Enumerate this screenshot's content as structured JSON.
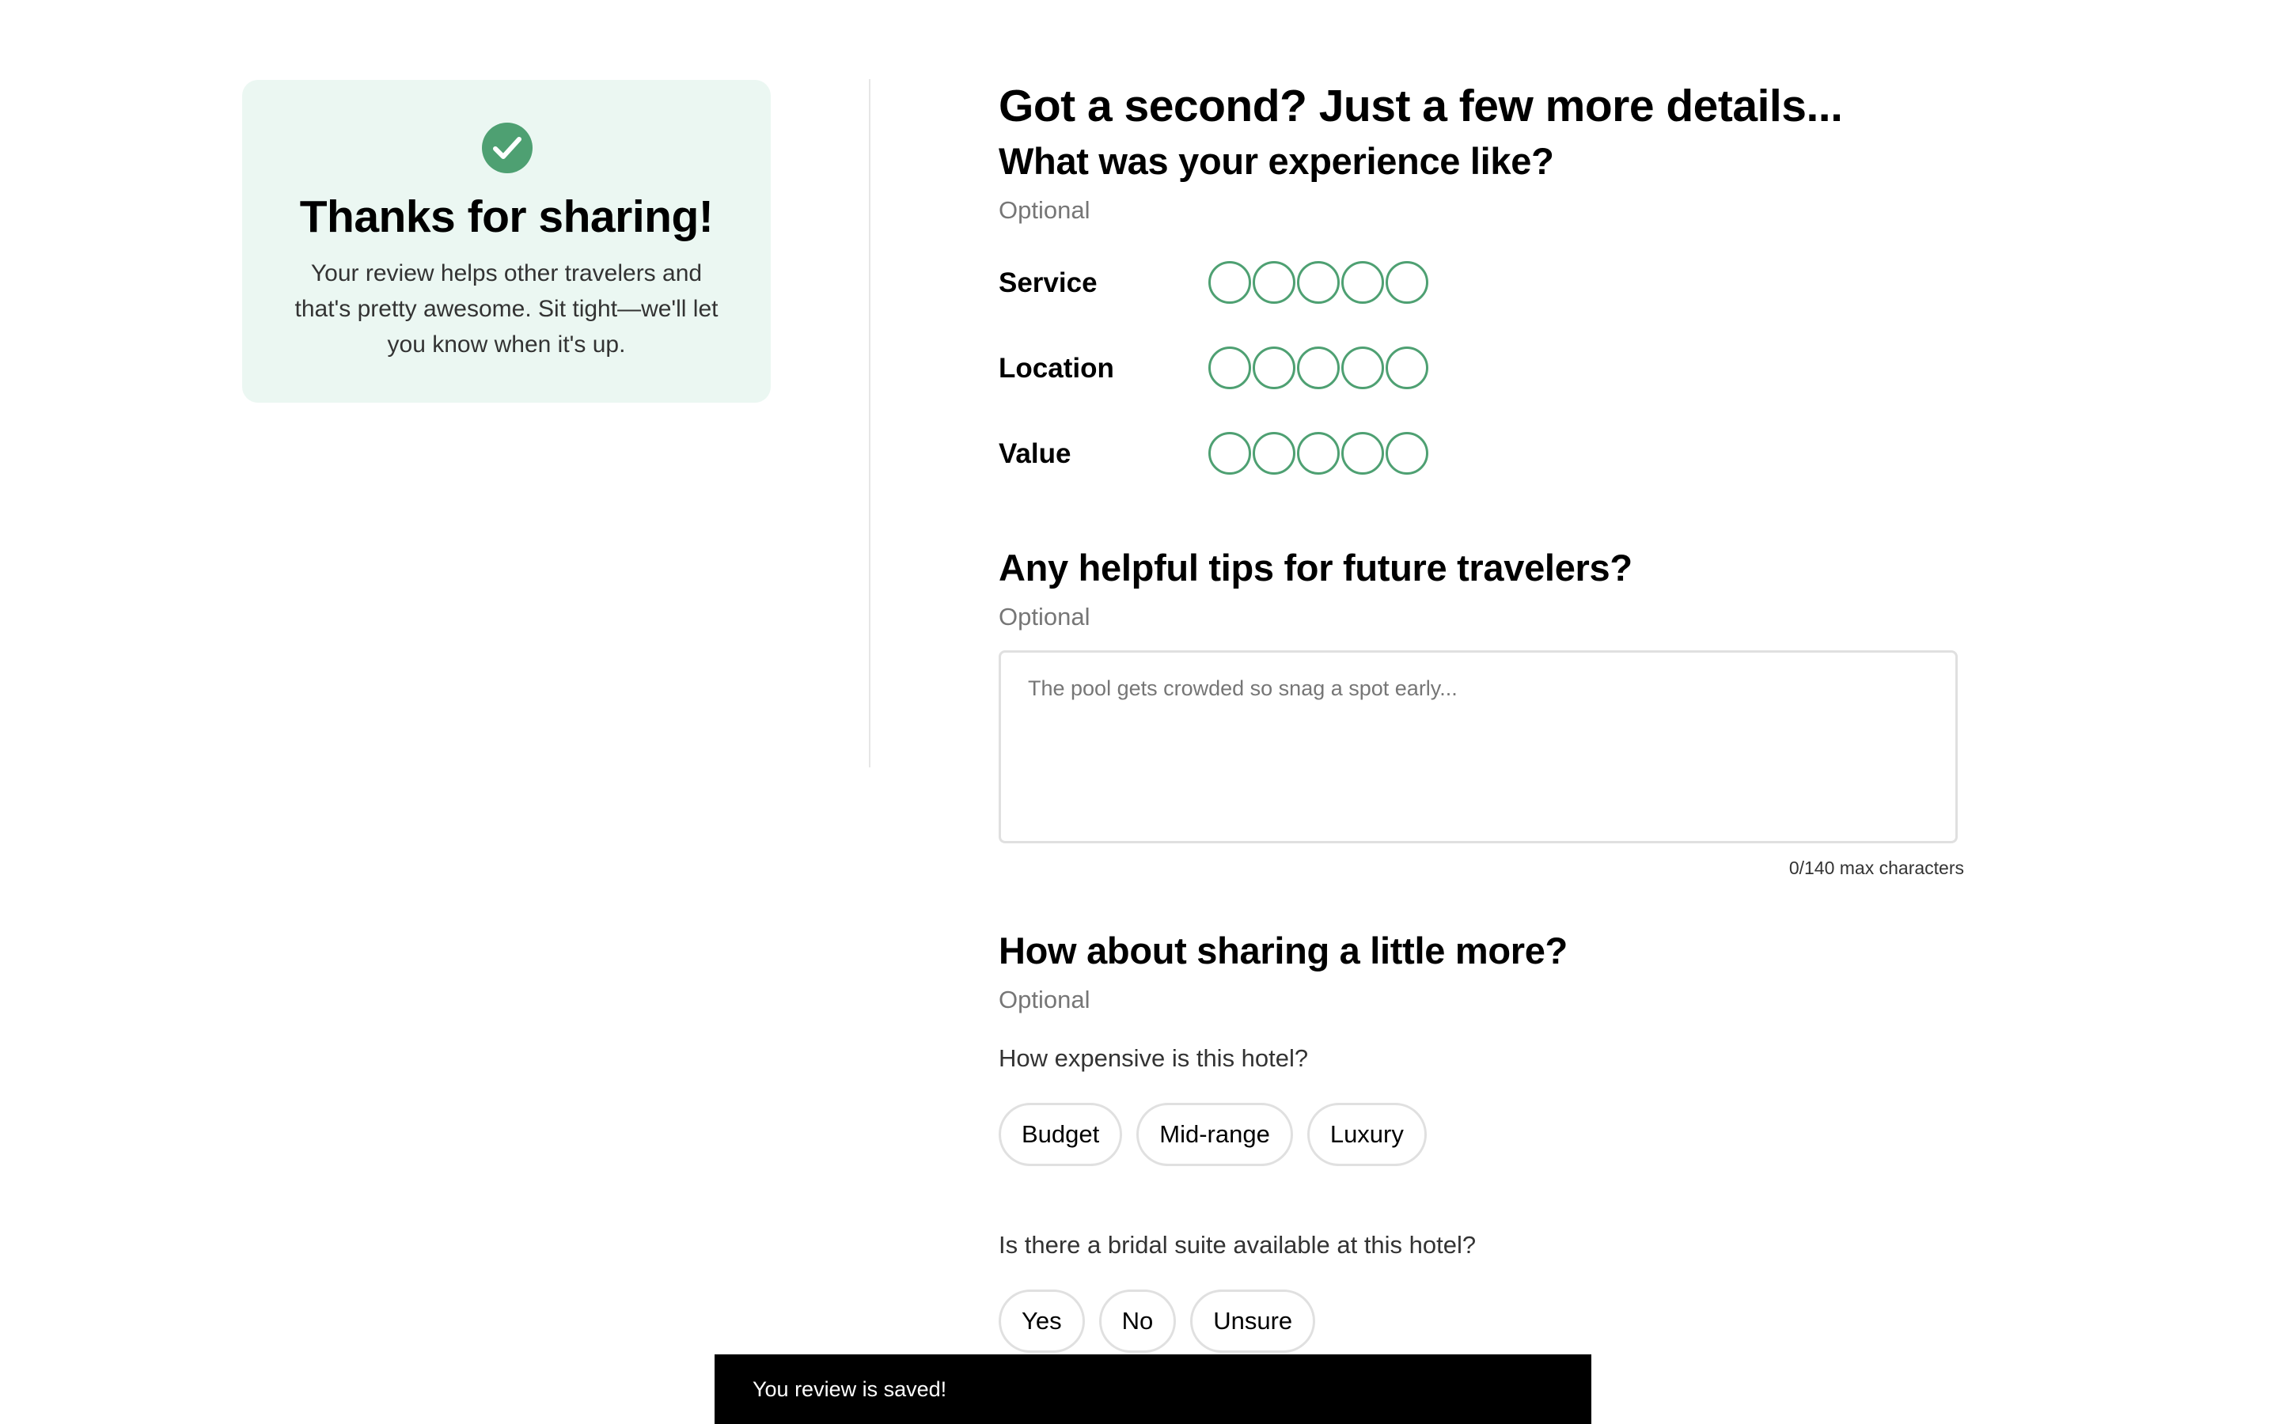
{
  "colors": {
    "accent_green": "#4ea072",
    "card_background": "#ebf7f2",
    "toast_background": "#000000"
  },
  "thanks_card": {
    "icon": "check-circle-icon",
    "title": "Thanks for sharing!",
    "body": "Your review helps other travelers and that's pretty awesome. Sit tight—we'll let you know when it's up."
  },
  "form": {
    "heading": "Got a second? Just a few more details...",
    "experience": {
      "heading": "What was your experience like?",
      "optional_label": "Optional",
      "ratings": [
        {
          "label": "Service",
          "value": 0,
          "max": 5
        },
        {
          "label": "Location",
          "value": 0,
          "max": 5
        },
        {
          "label": "Value",
          "value": 0,
          "max": 5
        }
      ]
    },
    "tips": {
      "heading": "Any helpful tips for future travelers?",
      "optional_label": "Optional",
      "value": "",
      "placeholder": "The pool gets crowded so snag a spot early...",
      "char_count": "0/140 max characters"
    },
    "more": {
      "heading": "How about sharing a little more?",
      "optional_label": "Optional",
      "price_question": "How expensive is this hotel?",
      "price_options": [
        "Budget",
        "Mid-range",
        "Luxury"
      ],
      "bridal_question": "Is there a bridal suite available at this hotel?",
      "bridal_options": [
        "Yes",
        "No",
        "Unsure"
      ]
    }
  },
  "toast": {
    "message": "You review is saved!"
  }
}
